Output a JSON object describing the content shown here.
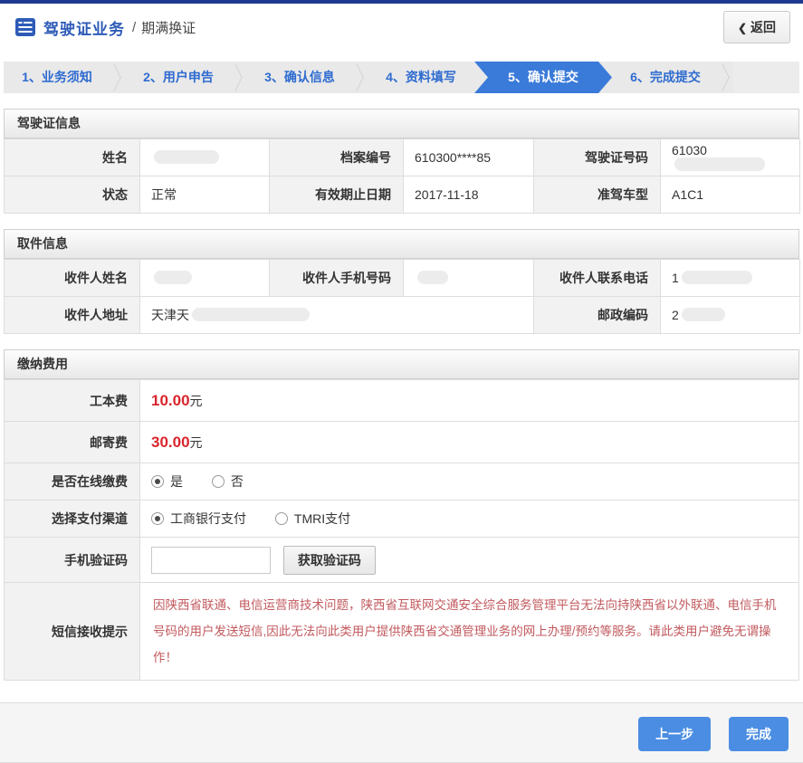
{
  "colors": {
    "top_bar_navy": "#1e3a8f",
    "accent_blue": "#2e5bb7",
    "step_text_blue": "#2e6bd0",
    "active_step_blue": "#3a7ad9",
    "price_red": "#d9252d",
    "notice_red": "#c25a5f",
    "button_blue": "#4a8de2"
  },
  "header": {
    "title_primary": "驾驶证业务",
    "title_separator": "/",
    "title_secondary": "期满换证",
    "back_icon": "❮",
    "back_label": "返回"
  },
  "steps": {
    "items": [
      {
        "label": "1、业务须知",
        "active": false
      },
      {
        "label": "2、用户申告",
        "active": false
      },
      {
        "label": "3、确认信息",
        "active": false
      },
      {
        "label": "4、资料填写",
        "active": false
      },
      {
        "label": "5、确认提交",
        "active": true
      },
      {
        "label": "6、完成提交",
        "active": false
      }
    ]
  },
  "license": {
    "header": "驾驶证信息",
    "name_label": "姓名",
    "file_no_label": "档案编号",
    "file_no_value": "610300****85",
    "license_no_label": "驾驶证号码",
    "license_no_value_prefix": "61030",
    "status_label": "状态",
    "status_value": "正常",
    "expiry_label": "有效期止日期",
    "expiry_value": "2017-11-18",
    "vehicle_label": "准驾车型",
    "vehicle_value": "A1C1"
  },
  "pickup": {
    "header": "取件信息",
    "recipient_name_label": "收件人姓名",
    "recipient_mobile_label": "收件人手机号码",
    "recipient_phone_label": "收件人联系电话",
    "recipient_phone_value_prefix": "1",
    "recipient_address_label": "收件人地址",
    "recipient_address_value_prefix": "天津天",
    "postcode_label": "邮政编码",
    "postcode_value_prefix": "2"
  },
  "fees": {
    "header": "缴纳费用",
    "production_fee_label": "工本费",
    "production_fee_value": "10.00",
    "postage_fee_label": "邮寄费",
    "postage_fee_value": "30.00",
    "fee_unit": "元",
    "online_pay_label": "是否在线缴费",
    "online_pay_options": [
      "是",
      "否"
    ],
    "online_pay_selected": "是",
    "channel_label": "选择支付渠道",
    "channel_options": [
      "工商银行支付",
      "TMRI支付"
    ],
    "channel_selected": "工商银行支付",
    "sms_code_label": "手机验证码",
    "sms_code_value": "",
    "get_code_button": "获取验证码",
    "sms_notice_label": "短信接收提示",
    "sms_notice_text": "因陕西省联通、电信运营商技术问题，陕西省互联网交通安全综合服务管理平台无法向持陕西省以外联通、电信手机号码的用户发送短信,因此无法向此类用户提供陕西省交通管理业务的网上办理/预约等服务。请此类用户避免无谓操作！"
  },
  "footer": {
    "prev_button": "上一步",
    "finish_button": "完成"
  }
}
